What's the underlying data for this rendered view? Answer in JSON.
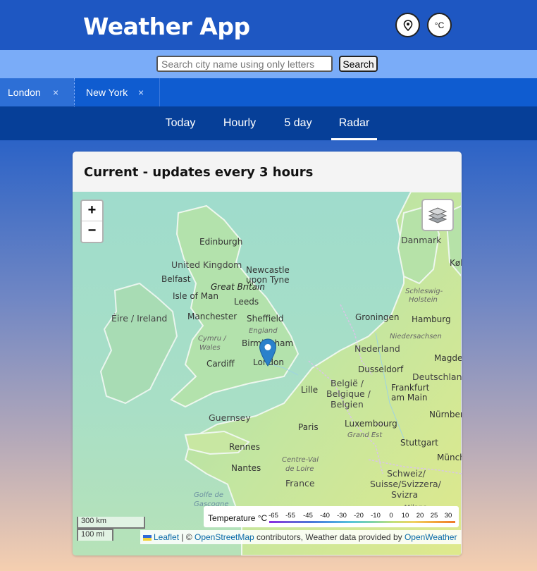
{
  "header": {
    "title": "Weather App",
    "location_icon": "location-pin-icon",
    "unit_label": "°C"
  },
  "search": {
    "placeholder": "Search city name using only letters",
    "value": "",
    "button_label": "Search"
  },
  "city_tabs": [
    {
      "label": "London",
      "close": "×"
    },
    {
      "label": "New York",
      "close": "×"
    }
  ],
  "nav_tabs": [
    {
      "label": "Today"
    },
    {
      "label": "Hourly"
    },
    {
      "label": "5 day"
    },
    {
      "label": "Radar",
      "active": true
    }
  ],
  "card": {
    "title": "Current - updates every 3 hours"
  },
  "map": {
    "zoom_in": "+",
    "zoom_out": "−",
    "layers_icon": "layers-icon",
    "marker_icon": "map-marker-icon",
    "labels": {
      "edinburgh": "Edinburgh",
      "uk": "United Kingdom",
      "newcastle": "Newcastle",
      "upon_tyne": "upon Tyne",
      "belfast": "Belfast",
      "great_britain": "Great Britain",
      "isle_of_man": "Isle of Man",
      "leeds": "Leeds",
      "eire": "Éire / Ireland",
      "manchester": "Manchester",
      "sheffield": "Sheffield",
      "england": "England",
      "cymru": "Cymru /",
      "wales": "Wales",
      "birmingham": "Birmingham",
      "cardiff": "Cardiff",
      "london": "London",
      "guernsey": "Guernsey",
      "rennes": "Rennes",
      "nantes": "Nantes",
      "golfe": "Golfe de",
      "gascogne": "Gascogne",
      "france": "France",
      "centre": "Centre-Val",
      "de_loire": "de Loire",
      "paris": "Paris",
      "lille": "Lille",
      "belgique1": "België /",
      "belgique2": "Belgique /",
      "belgien": "Belgien",
      "luxembourg": "Luxembourg",
      "grand_est": "Grand Est",
      "nederland": "Nederland",
      "dusseldorf": "Dusseldorf",
      "groningen": "Groningen",
      "hamburg": "Hamburg",
      "niedersachsen": "Niedersachsen",
      "deutschland": "Deutschland",
      "frankfurt": "Frankfurt",
      "am_main": "am Main",
      "stuttgart": "Stuttgart",
      "nurnberg": "Nürnberg",
      "munchen": "Münch",
      "schweiz1": "Schweiz/",
      "schweiz2": "Suisse/Svizzera/",
      "schweiz3": "Svizra",
      "danmark": "Danmark",
      "schleswig": "Schleswig-",
      "holstein": "Holstein",
      "magdeb": "Magdeb",
      "kob": "Køb",
      "milano": "Milano"
    },
    "scale": {
      "km": "300 km",
      "mi": "100 mi"
    },
    "legend": {
      "title": "Temperature °C",
      "ticks": [
        "-65",
        "-55",
        "-45",
        "-40",
        "-30",
        "-20",
        "-10",
        "0",
        "10",
        "20",
        "25",
        "30"
      ]
    },
    "attribution": {
      "leaflet": "Leaflet",
      "sep": " | © ",
      "osm": "OpenStreetMap",
      "middle": " contributors, Weather data provided by ",
      "owm": "OpenWeather"
    }
  },
  "colors": {
    "header_bg": "#1e57c2",
    "searchbar_bg": "#7aacf8",
    "citytabs_bg": "#0f5cd0",
    "navbar_bg": "#063f98",
    "marker": "#2a81cb"
  }
}
